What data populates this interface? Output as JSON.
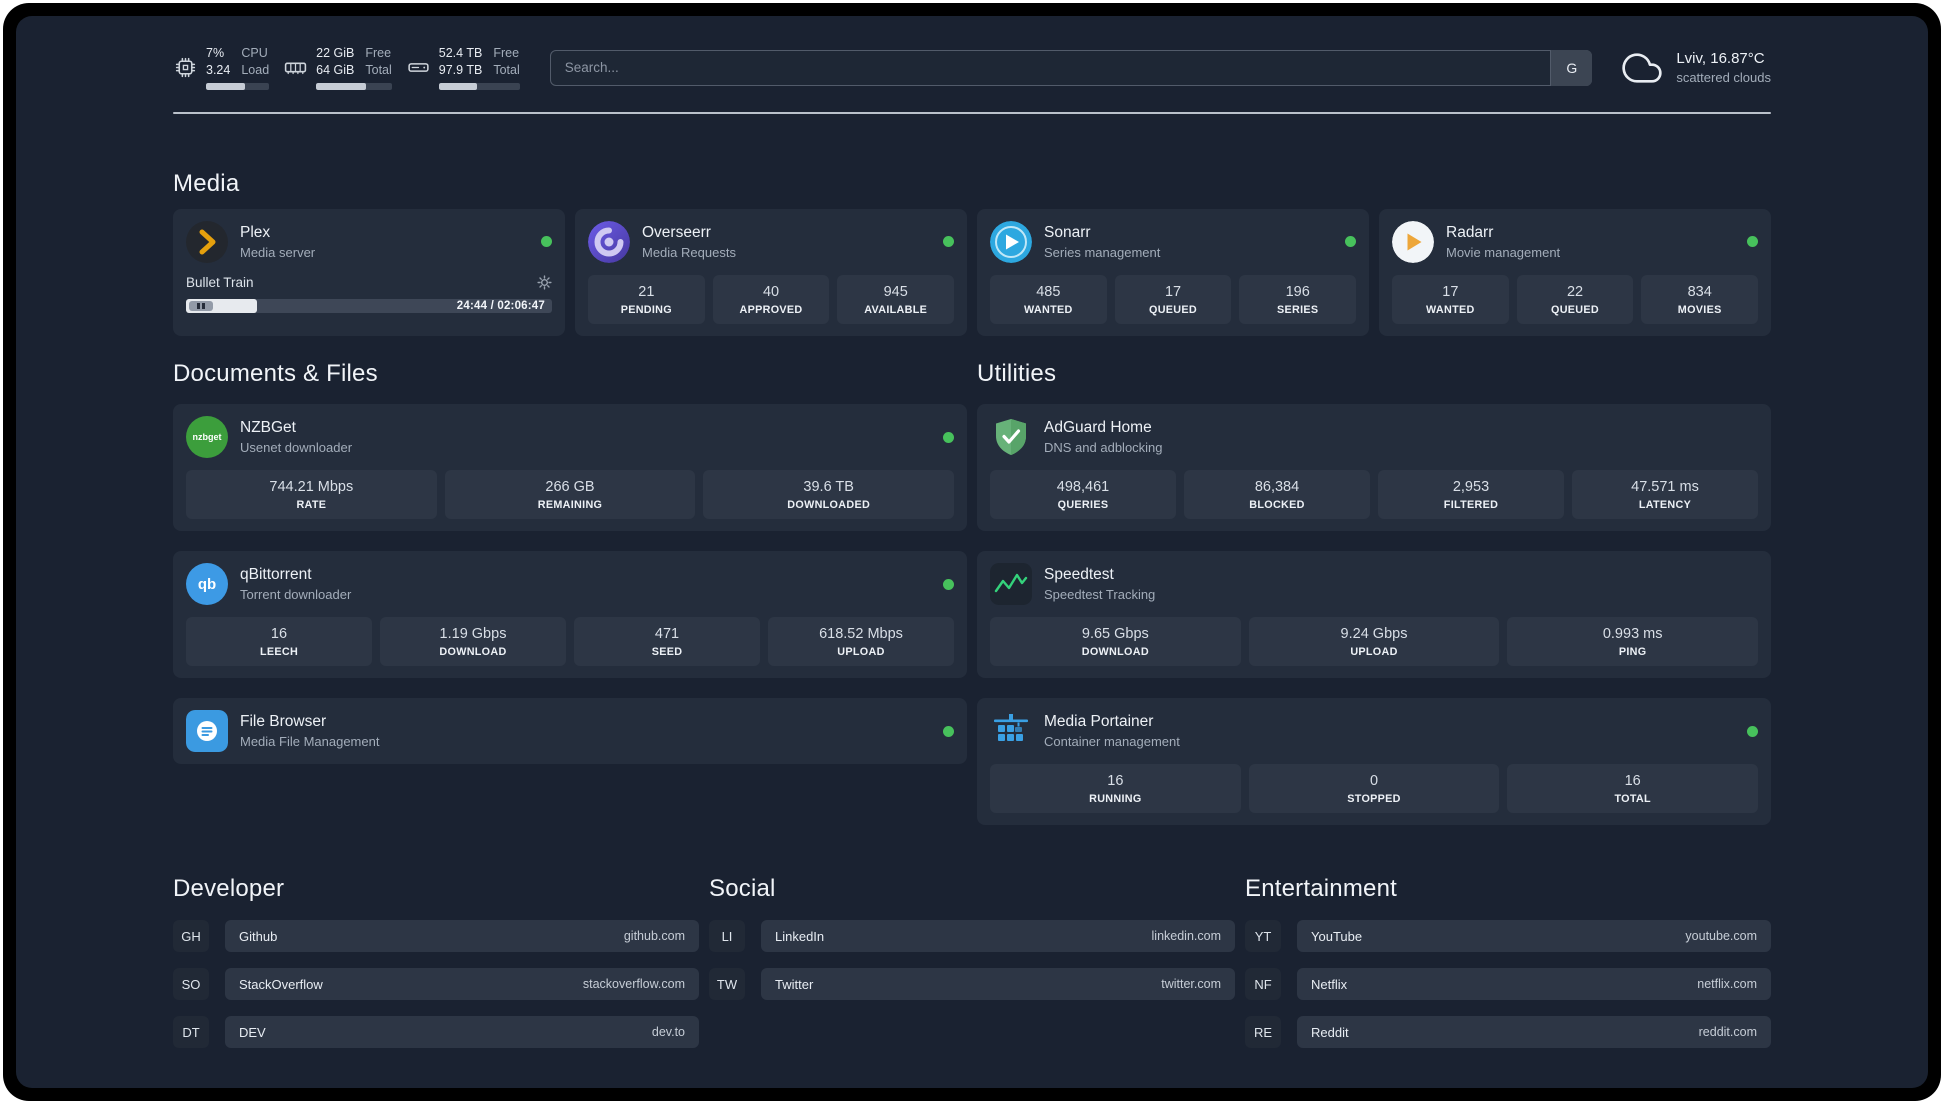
{
  "topbar": {
    "monitors": [
      {
        "icon": "cpu-icon",
        "values": [
          "7%",
          "3.24"
        ],
        "labels": [
          "CPU",
          "Load"
        ],
        "bar_percent": 62,
        "bar_style": "width:62%"
      },
      {
        "icon": "ram-icon",
        "values": [
          "22 GiB",
          "64 GiB"
        ],
        "labels": [
          "Free",
          "Total"
        ],
        "bar_percent": 66,
        "bar_style": "width:66%"
      },
      {
        "icon": "disk-icon",
        "values": [
          "52.4 TB",
          "97.9 TB"
        ],
        "labels": [
          "Free",
          "Total"
        ],
        "bar_percent": 47,
        "bar_style": "width:47%"
      }
    ],
    "search": {
      "placeholder": "Search...",
      "provider_button": "G"
    },
    "weather": {
      "location": "Lviv, 16.87°C",
      "condition": "scattered clouds"
    }
  },
  "colors": {
    "status_online": "#47c15c",
    "card": "#242d3c",
    "tile": "#2d3645",
    "background": "#1a2231"
  },
  "sections": {
    "media": {
      "title": "Media",
      "plex": {
        "name": "Plex",
        "subtitle": "Media server",
        "status": "online",
        "now_playing": {
          "title": "Bullet Train",
          "time": "24:44 / 02:06:47",
          "progress_percent": 19.5,
          "progress_style": "width:19.5%"
        }
      },
      "overseerr": {
        "name": "Overseerr",
        "subtitle": "Media Requests",
        "status": "online",
        "stats": [
          {
            "value": "21",
            "label": "PENDING"
          },
          {
            "value": "40",
            "label": "APPROVED"
          },
          {
            "value": "945",
            "label": "AVAILABLE"
          }
        ]
      },
      "sonarr": {
        "name": "Sonarr",
        "subtitle": "Series management",
        "status": "online",
        "stats": [
          {
            "value": "485",
            "label": "WANTED"
          },
          {
            "value": "17",
            "label": "QUEUED"
          },
          {
            "value": "196",
            "label": "SERIES"
          }
        ]
      },
      "radarr": {
        "name": "Radarr",
        "subtitle": "Movie management",
        "status": "online",
        "stats": [
          {
            "value": "17",
            "label": "WANTED"
          },
          {
            "value": "22",
            "label": "QUEUED"
          },
          {
            "value": "834",
            "label": "MOVIES"
          }
        ]
      }
    },
    "documents": {
      "title": "Documents & Files",
      "nzbget": {
        "name": "NZBGet",
        "subtitle": "Usenet downloader",
        "status": "online",
        "icon_text": "nzbget",
        "stats": [
          {
            "value": "744.21 Mbps",
            "label": "RATE"
          },
          {
            "value": "266 GB",
            "label": "REMAINING"
          },
          {
            "value": "39.6 TB",
            "label": "DOWNLOADED"
          }
        ]
      },
      "qbittorrent": {
        "name": "qBittorrent",
        "subtitle": "Torrent downloader",
        "status": "online",
        "icon_text": "qb",
        "stats": [
          {
            "value": "16",
            "label": "LEECH"
          },
          {
            "value": "1.19 Gbps",
            "label": "DOWNLOAD"
          },
          {
            "value": "471",
            "label": "SEED"
          },
          {
            "value": "618.52 Mbps",
            "label": "UPLOAD"
          }
        ]
      },
      "filebrowser": {
        "name": "File Browser",
        "subtitle": "Media File Management",
        "status": "online"
      }
    },
    "utilities": {
      "title": "Utilities",
      "adguard": {
        "name": "AdGuard Home",
        "subtitle": "DNS and adblocking",
        "stats": [
          {
            "value": "498,461",
            "label": "QUERIES"
          },
          {
            "value": "86,384",
            "label": "BLOCKED"
          },
          {
            "value": "2,953",
            "label": "FILTERED"
          },
          {
            "value": "47.571 ms",
            "label": "LATENCY"
          }
        ]
      },
      "speedtest": {
        "name": "Speedtest",
        "subtitle": "Speedtest Tracking",
        "stats": [
          {
            "value": "9.65 Gbps",
            "label": "DOWNLOAD"
          },
          {
            "value": "9.24 Gbps",
            "label": "UPLOAD"
          },
          {
            "value": "0.993 ms",
            "label": "PING"
          }
        ]
      },
      "portainer": {
        "name": "Media Portainer",
        "subtitle": "Container management",
        "status": "online",
        "stats": [
          {
            "value": "16",
            "label": "RUNNING"
          },
          {
            "value": "0",
            "label": "STOPPED"
          },
          {
            "value": "16",
            "label": "TOTAL"
          }
        ]
      }
    },
    "bookmarks": [
      {
        "title": "Developer",
        "items": [
          {
            "abbr": "GH",
            "name": "Github",
            "domain": "github.com"
          },
          {
            "abbr": "SO",
            "name": "StackOverflow",
            "domain": "stackoverflow.com"
          },
          {
            "abbr": "DT",
            "name": "DEV",
            "domain": "dev.to"
          }
        ]
      },
      {
        "title": "Social",
        "items": [
          {
            "abbr": "LI",
            "name": "LinkedIn",
            "domain": "linkedin.com"
          },
          {
            "abbr": "TW",
            "name": "Twitter",
            "domain": "twitter.com"
          }
        ]
      },
      {
        "title": "Entertainment",
        "items": [
          {
            "abbr": "YT",
            "name": "YouTube",
            "domain": "youtube.com"
          },
          {
            "abbr": "NF",
            "name": "Netflix",
            "domain": "netflix.com"
          },
          {
            "abbr": "RE",
            "name": "Reddit",
            "domain": "reddit.com"
          }
        ]
      }
    ]
  }
}
